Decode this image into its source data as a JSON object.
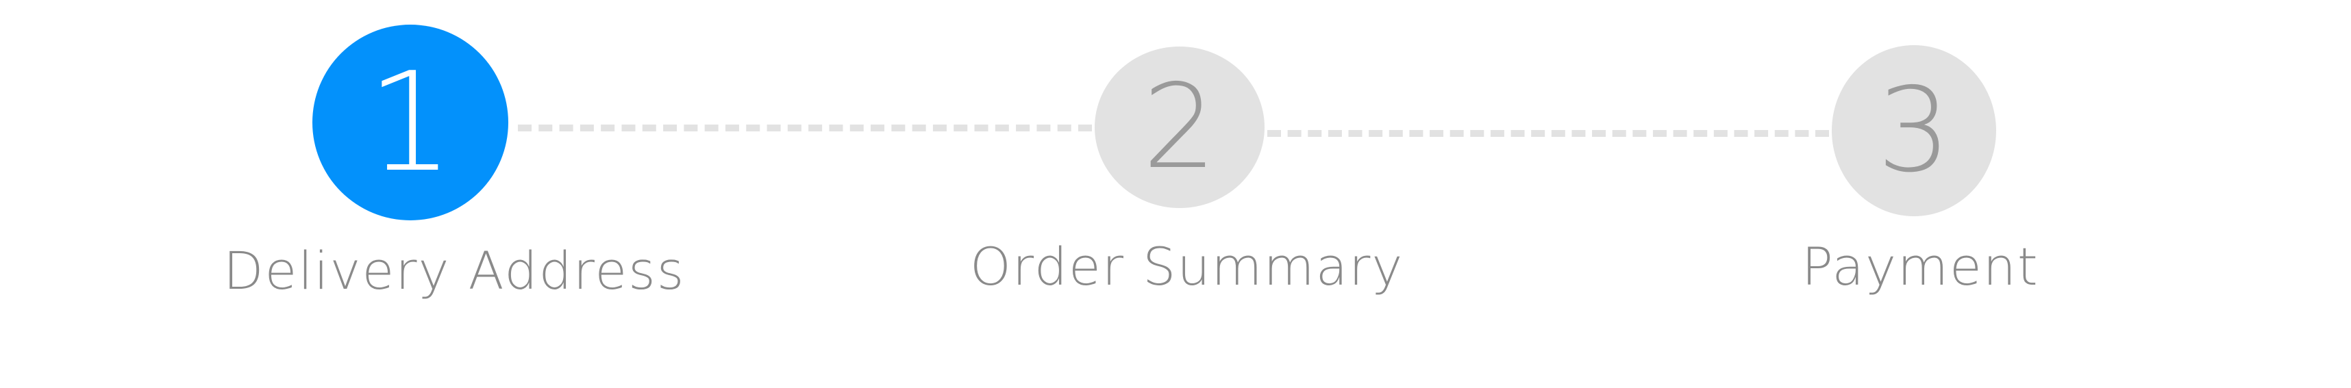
{
  "stepper": {
    "steps": [
      {
        "number": "1",
        "label": "Delivery Address",
        "state": "active"
      },
      {
        "number": "2",
        "label": "Order Summary",
        "state": "inactive"
      },
      {
        "number": "3",
        "label": "Payment",
        "state": "inactive"
      }
    ],
    "current_step": 1
  },
  "colors": {
    "active_circle": "#0391fb",
    "inactive_circle": "#e2e2e2",
    "inactive_number": "#9a9a9a",
    "label_text": "#8a8a8a",
    "connector": "#e2e2e2"
  }
}
